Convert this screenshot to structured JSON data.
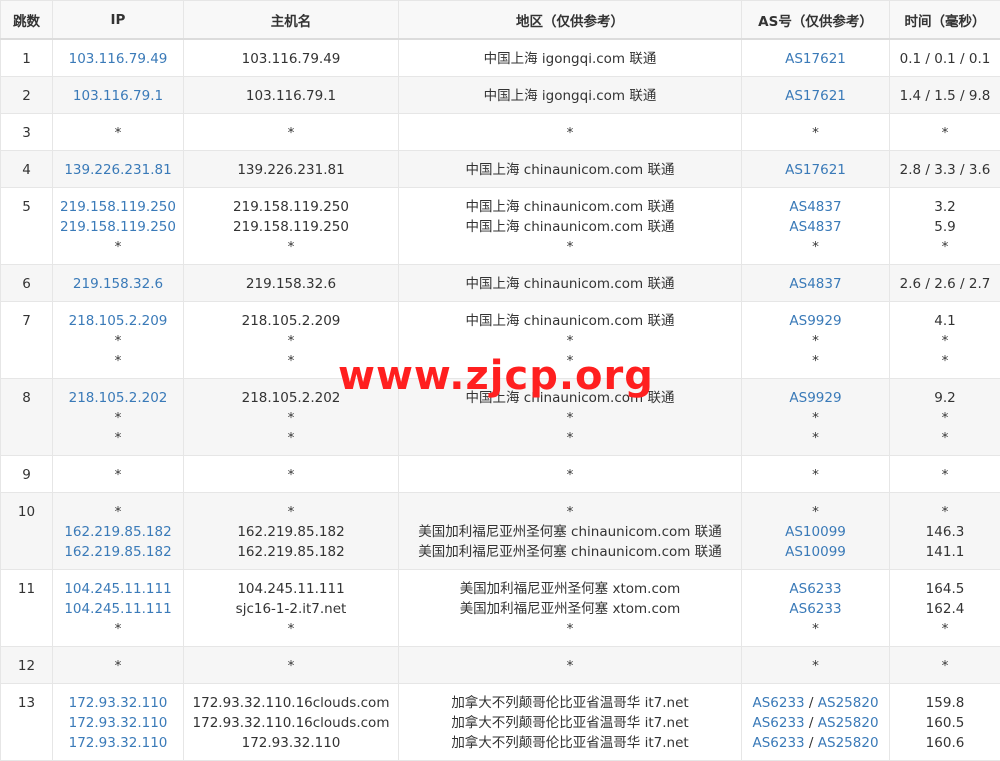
{
  "headers": [
    "跳数",
    "IP",
    "主机名",
    "地区（仅供参考）",
    "AS号（仅供参考）",
    "时间（毫秒）"
  ],
  "rows": [
    {
      "hop": "1",
      "ip": [
        "103.116.79.49"
      ],
      "host": [
        "103.116.79.49"
      ],
      "region": [
        "中国上海 igongqi.com 联通"
      ],
      "as": [
        [
          "AS17621"
        ]
      ],
      "time": [
        "0.1 / 0.1 / 0.1"
      ]
    },
    {
      "hop": "2",
      "ip": [
        "103.116.79.1"
      ],
      "host": [
        "103.116.79.1"
      ],
      "region": [
        "中国上海 igongqi.com 联通"
      ],
      "as": [
        [
          "AS17621"
        ]
      ],
      "time": [
        "1.4 / 1.5 / 9.8"
      ]
    },
    {
      "hop": "3",
      "ip": [
        "*"
      ],
      "host": [
        "*"
      ],
      "region": [
        "*"
      ],
      "as": [
        [
          "*"
        ]
      ],
      "time": [
        "*"
      ]
    },
    {
      "hop": "4",
      "ip": [
        "139.226.231.81"
      ],
      "host": [
        "139.226.231.81"
      ],
      "region": [
        "中国上海 chinaunicom.com 联通"
      ],
      "as": [
        [
          "AS17621"
        ]
      ],
      "time": [
        "2.8 / 3.3 / 3.6"
      ]
    },
    {
      "hop": "5",
      "ip": [
        "219.158.119.250",
        "219.158.119.250",
        "*"
      ],
      "host": [
        "219.158.119.250",
        "219.158.119.250",
        "*"
      ],
      "region": [
        "中国上海 chinaunicom.com 联通",
        "中国上海 chinaunicom.com 联通",
        "*"
      ],
      "as": [
        [
          "AS4837"
        ],
        [
          "AS4837"
        ],
        [
          "*"
        ]
      ],
      "time": [
        "3.2",
        "5.9",
        "*"
      ]
    },
    {
      "hop": "6",
      "ip": [
        "219.158.32.6"
      ],
      "host": [
        "219.158.32.6"
      ],
      "region": [
        "中国上海 chinaunicom.com 联通"
      ],
      "as": [
        [
          "AS4837"
        ]
      ],
      "time": [
        "2.6 / 2.6 / 2.7"
      ]
    },
    {
      "hop": "7",
      "ip": [
        "218.105.2.209",
        "*",
        "*"
      ],
      "host": [
        "218.105.2.209",
        "*",
        "*"
      ],
      "region": [
        "中国上海 chinaunicom.com 联通",
        "*",
        "*"
      ],
      "as": [
        [
          "AS9929"
        ],
        [
          "*"
        ],
        [
          "*"
        ]
      ],
      "time": [
        "4.1",
        "*",
        "*"
      ]
    },
    {
      "hop": "8",
      "ip": [
        "218.105.2.202",
        "*",
        "*"
      ],
      "host": [
        "218.105.2.202",
        "*",
        "*"
      ],
      "region": [
        "中国上海 chinaunicom.com 联通",
        "*",
        "*"
      ],
      "as": [
        [
          "AS9929"
        ],
        [
          "*"
        ],
        [
          "*"
        ]
      ],
      "time": [
        "9.2",
        "*",
        "*"
      ]
    },
    {
      "hop": "9",
      "ip": [
        "*"
      ],
      "host": [
        "*"
      ],
      "region": [
        "*"
      ],
      "as": [
        [
          "*"
        ]
      ],
      "time": [
        "*"
      ]
    },
    {
      "hop": "10",
      "ip": [
        "*",
        "162.219.85.182",
        "162.219.85.182"
      ],
      "host": [
        "*",
        "162.219.85.182",
        "162.219.85.182"
      ],
      "region": [
        "*",
        "美国加利福尼亚州圣何塞 chinaunicom.com 联通",
        "美国加利福尼亚州圣何塞 chinaunicom.com 联通"
      ],
      "as": [
        [
          "*"
        ],
        [
          "AS10099"
        ],
        [
          "AS10099"
        ]
      ],
      "time": [
        "*",
        "146.3",
        "141.1"
      ]
    },
    {
      "hop": "11",
      "ip": [
        "104.245.11.111",
        "104.245.11.111",
        "*"
      ],
      "host": [
        "104.245.11.111",
        "sjc16-1-2.it7.net",
        "*"
      ],
      "region": [
        "美国加利福尼亚州圣何塞 xtom.com",
        "美国加利福尼亚州圣何塞 xtom.com",
        "*"
      ],
      "as": [
        [
          "AS6233"
        ],
        [
          "AS6233"
        ],
        [
          "*"
        ]
      ],
      "time": [
        "164.5",
        "162.4",
        "*"
      ]
    },
    {
      "hop": "12",
      "ip": [
        "*"
      ],
      "host": [
        "*"
      ],
      "region": [
        "*"
      ],
      "as": [
        [
          "*"
        ]
      ],
      "time": [
        "*"
      ]
    },
    {
      "hop": "13",
      "ip": [
        "172.93.32.110",
        "172.93.32.110",
        "172.93.32.110"
      ],
      "host": [
        "172.93.32.110.16clouds.com",
        "172.93.32.110.16clouds.com",
        "172.93.32.110"
      ],
      "region": [
        "加拿大不列颠哥伦比亚省温哥华 it7.net",
        "加拿大不列颠哥伦比亚省温哥华 it7.net",
        "加拿大不列颠哥伦比亚省温哥华 it7.net"
      ],
      "as": [
        [
          "AS6233",
          "AS25820"
        ],
        [
          "AS6233",
          "AS25820"
        ],
        [
          "AS6233",
          "AS25820"
        ]
      ],
      "time": [
        "159.8",
        "160.5",
        "160.6"
      ]
    }
  ],
  "as_separator": " / ",
  "watermark": "www.zjcp.org",
  "colors": {
    "link": "#3a7ab8",
    "watermark": "#ff1f1f",
    "alt_row": "#f6f6f6",
    "header_bg": "#f8f8f8"
  }
}
